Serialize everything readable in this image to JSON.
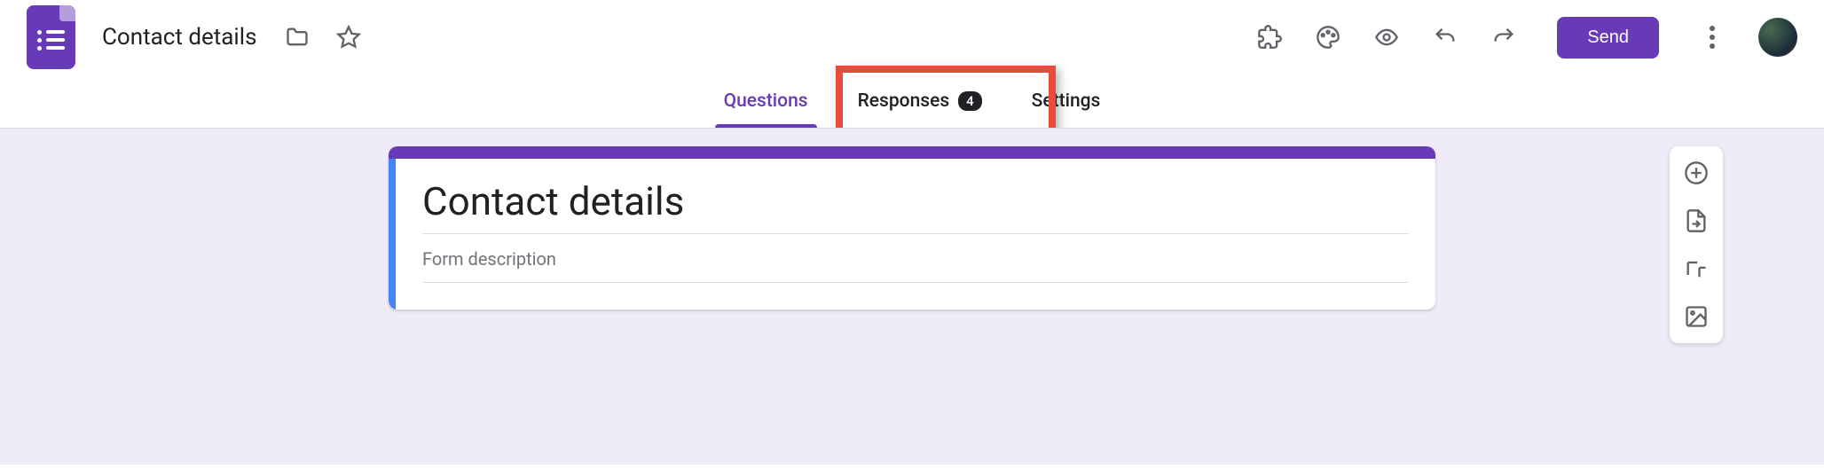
{
  "header": {
    "doc_title": "Contact details"
  },
  "tabs": {
    "questions": "Questions",
    "responses": "Responses",
    "responses_count": "4",
    "settings": "Settings"
  },
  "send_label": "Send",
  "form": {
    "title": "Contact details",
    "description_placeholder": "Form description"
  },
  "colors": {
    "brand": "#673ab7",
    "background": "#f0ebf8",
    "accent_blue": "#4285f4",
    "highlight": "#e74c3c"
  }
}
